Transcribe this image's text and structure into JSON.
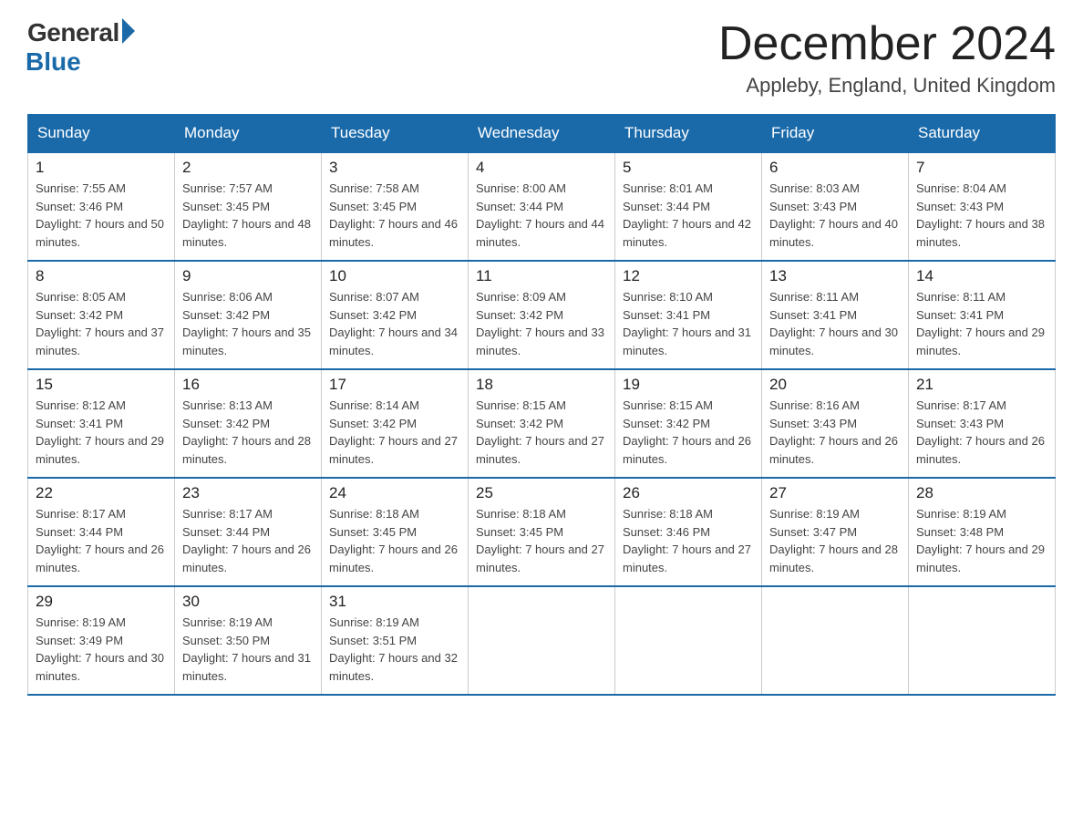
{
  "header": {
    "logo_general": "General",
    "logo_blue": "Blue",
    "title": "December 2024",
    "location": "Appleby, England, United Kingdom"
  },
  "days_of_week": [
    "Sunday",
    "Monday",
    "Tuesday",
    "Wednesday",
    "Thursday",
    "Friday",
    "Saturday"
  ],
  "weeks": [
    [
      {
        "day": "1",
        "sunrise": "7:55 AM",
        "sunset": "3:46 PM",
        "daylight": "7 hours and 50 minutes."
      },
      {
        "day": "2",
        "sunrise": "7:57 AM",
        "sunset": "3:45 PM",
        "daylight": "7 hours and 48 minutes."
      },
      {
        "day": "3",
        "sunrise": "7:58 AM",
        "sunset": "3:45 PM",
        "daylight": "7 hours and 46 minutes."
      },
      {
        "day": "4",
        "sunrise": "8:00 AM",
        "sunset": "3:44 PM",
        "daylight": "7 hours and 44 minutes."
      },
      {
        "day": "5",
        "sunrise": "8:01 AM",
        "sunset": "3:44 PM",
        "daylight": "7 hours and 42 minutes."
      },
      {
        "day": "6",
        "sunrise": "8:03 AM",
        "sunset": "3:43 PM",
        "daylight": "7 hours and 40 minutes."
      },
      {
        "day": "7",
        "sunrise": "8:04 AM",
        "sunset": "3:43 PM",
        "daylight": "7 hours and 38 minutes."
      }
    ],
    [
      {
        "day": "8",
        "sunrise": "8:05 AM",
        "sunset": "3:42 PM",
        "daylight": "7 hours and 37 minutes."
      },
      {
        "day": "9",
        "sunrise": "8:06 AM",
        "sunset": "3:42 PM",
        "daylight": "7 hours and 35 minutes."
      },
      {
        "day": "10",
        "sunrise": "8:07 AM",
        "sunset": "3:42 PM",
        "daylight": "7 hours and 34 minutes."
      },
      {
        "day": "11",
        "sunrise": "8:09 AM",
        "sunset": "3:42 PM",
        "daylight": "7 hours and 33 minutes."
      },
      {
        "day": "12",
        "sunrise": "8:10 AM",
        "sunset": "3:41 PM",
        "daylight": "7 hours and 31 minutes."
      },
      {
        "day": "13",
        "sunrise": "8:11 AM",
        "sunset": "3:41 PM",
        "daylight": "7 hours and 30 minutes."
      },
      {
        "day": "14",
        "sunrise": "8:11 AM",
        "sunset": "3:41 PM",
        "daylight": "7 hours and 29 minutes."
      }
    ],
    [
      {
        "day": "15",
        "sunrise": "8:12 AM",
        "sunset": "3:41 PM",
        "daylight": "7 hours and 29 minutes."
      },
      {
        "day": "16",
        "sunrise": "8:13 AM",
        "sunset": "3:42 PM",
        "daylight": "7 hours and 28 minutes."
      },
      {
        "day": "17",
        "sunrise": "8:14 AM",
        "sunset": "3:42 PM",
        "daylight": "7 hours and 27 minutes."
      },
      {
        "day": "18",
        "sunrise": "8:15 AM",
        "sunset": "3:42 PM",
        "daylight": "7 hours and 27 minutes."
      },
      {
        "day": "19",
        "sunrise": "8:15 AM",
        "sunset": "3:42 PM",
        "daylight": "7 hours and 26 minutes."
      },
      {
        "day": "20",
        "sunrise": "8:16 AM",
        "sunset": "3:43 PM",
        "daylight": "7 hours and 26 minutes."
      },
      {
        "day": "21",
        "sunrise": "8:17 AM",
        "sunset": "3:43 PM",
        "daylight": "7 hours and 26 minutes."
      }
    ],
    [
      {
        "day": "22",
        "sunrise": "8:17 AM",
        "sunset": "3:44 PM",
        "daylight": "7 hours and 26 minutes."
      },
      {
        "day": "23",
        "sunrise": "8:17 AM",
        "sunset": "3:44 PM",
        "daylight": "7 hours and 26 minutes."
      },
      {
        "day": "24",
        "sunrise": "8:18 AM",
        "sunset": "3:45 PM",
        "daylight": "7 hours and 26 minutes."
      },
      {
        "day": "25",
        "sunrise": "8:18 AM",
        "sunset": "3:45 PM",
        "daylight": "7 hours and 27 minutes."
      },
      {
        "day": "26",
        "sunrise": "8:18 AM",
        "sunset": "3:46 PM",
        "daylight": "7 hours and 27 minutes."
      },
      {
        "day": "27",
        "sunrise": "8:19 AM",
        "sunset": "3:47 PM",
        "daylight": "7 hours and 28 minutes."
      },
      {
        "day": "28",
        "sunrise": "8:19 AM",
        "sunset": "3:48 PM",
        "daylight": "7 hours and 29 minutes."
      }
    ],
    [
      {
        "day": "29",
        "sunrise": "8:19 AM",
        "sunset": "3:49 PM",
        "daylight": "7 hours and 30 minutes."
      },
      {
        "day": "30",
        "sunrise": "8:19 AM",
        "sunset": "3:50 PM",
        "daylight": "7 hours and 31 minutes."
      },
      {
        "day": "31",
        "sunrise": "8:19 AM",
        "sunset": "3:51 PM",
        "daylight": "7 hours and 32 minutes."
      },
      null,
      null,
      null,
      null
    ]
  ]
}
